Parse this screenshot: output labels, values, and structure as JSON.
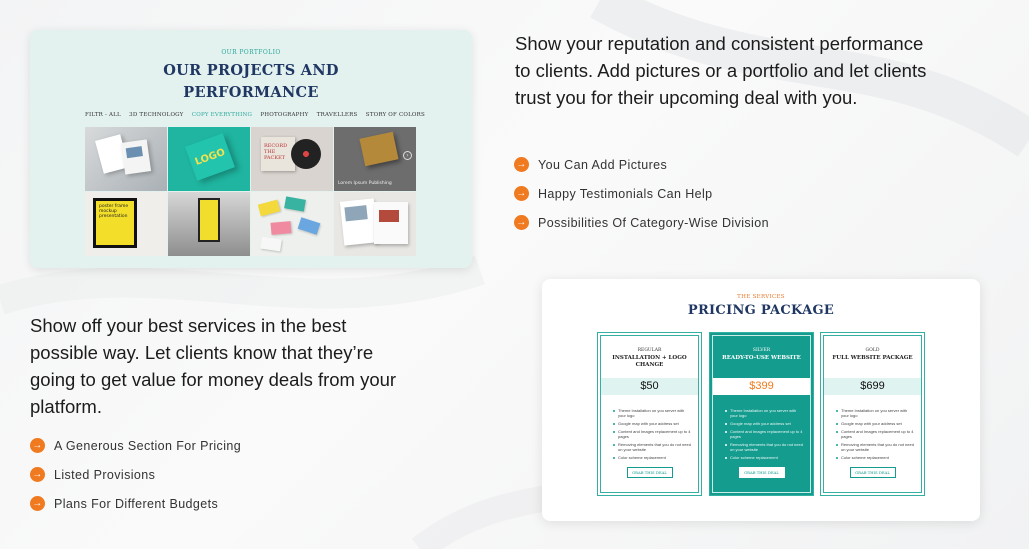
{
  "colors": {
    "accent_orange": "#f07a1f",
    "teal": "#149c8e",
    "navy": "#1f3762"
  },
  "portfolio": {
    "eyebrow": "OUR PORTFOLIO",
    "title_line1": "OUR PROJECTS AND",
    "title_line2": "PERFORMANCE",
    "filters": [
      "FILTR - ALL",
      "3D TECHNOLOGY",
      "COPY EVERYTHING",
      "PHOTOGRAPHY",
      "TRAVELLERS",
      "STORY OF COLORS"
    ],
    "active_filter": "COPY EVERYTHING",
    "tile_texts": {
      "logo": "LOGO",
      "record": "RECORD THE PACKET",
      "caption": "Lorem Ipsum Publishing",
      "poster": "poster frame mockup presentation"
    }
  },
  "section1": {
    "description": "Show your reputation and consistent performance to clients. Add pictures or a portfolio and let clients trust you for their upcoming deal with you.",
    "features": [
      "You Can Add Pictures",
      "Happy Testimonials Can Help",
      "Possibilities Of Category-Wise Division"
    ]
  },
  "section2": {
    "description": "Show off your best services in the best possible way. Let clients know that they’re going to get value for money deals from your platform.",
    "features": [
      "A Generous Section For Pricing",
      "Listed Provisions",
      "Plans For Different Budgets"
    ]
  },
  "pricing": {
    "eyebrow": "THE SERVICES",
    "title": "PRICING PACKAGE",
    "plans": [
      {
        "tier": "REGULAR",
        "name": "INSTALLATION + LOGO CHANGE",
        "price": "$50",
        "features": [
          "Theme Installation on you server with your logo",
          "Google map with your address set",
          "Content and Images replacement up to 4 pages",
          "Removing elements that you do not need on your website",
          "Color scheme replacement"
        ],
        "button": "GRAB THIS DEAL"
      },
      {
        "tier": "SILVER",
        "name": "READY-TO-USE WEBSITE",
        "price": "$399",
        "features": [
          "Theme Installation on you server with your logo",
          "Google map with your address set",
          "Content and Images replacement up to 4 pages",
          "Removing elements that you do not need on your website",
          "Color scheme replacement"
        ],
        "button": "GRAB THIS DEAL"
      },
      {
        "tier": "GOLD",
        "name": "FULL WEBSITE PACKAGE",
        "price": "$699",
        "features": [
          "Theme Installation on you server with your logo",
          "Google map with your address set",
          "Content and Images replacement up to 4 pages",
          "Removing elements that you do not need on your website",
          "Color scheme replacement"
        ],
        "button": "GRAB THIS DEAL"
      }
    ]
  }
}
